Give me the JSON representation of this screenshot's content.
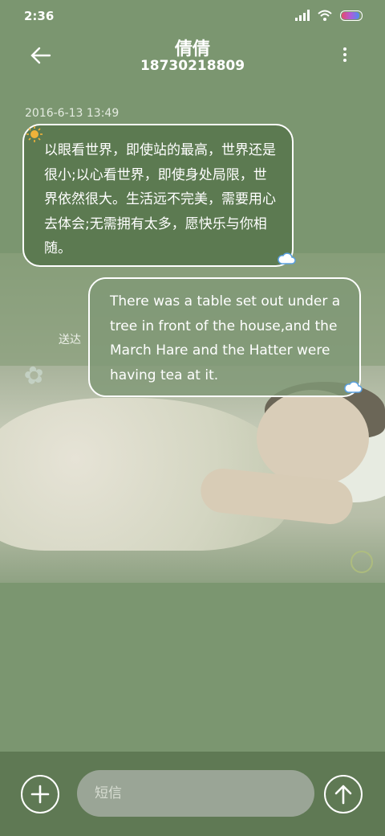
{
  "status_bar": {
    "time": "2:36"
  },
  "header": {
    "title": "倩倩",
    "phone": "18730218809"
  },
  "conversation": {
    "timestamp": "2016-6-13 13:49",
    "incoming_message": "以眼看世界，即使站的最高，世界还是很小;以心看世界，即使身处局限，世界依然很大。生活远不完美，需要用心去体会;无需拥有太多，愿快乐与你相随。",
    "outgoing_message": "There was a table set out under a tree in front of the house,and the March Hare and the Hatter were having tea at it.",
    "outgoing_status": "送达"
  },
  "input": {
    "placeholder": "短信"
  },
  "colors": {
    "background": "#7b9670",
    "bubble_in": "#5c7a51",
    "bottom_bar": "#5f7954"
  }
}
